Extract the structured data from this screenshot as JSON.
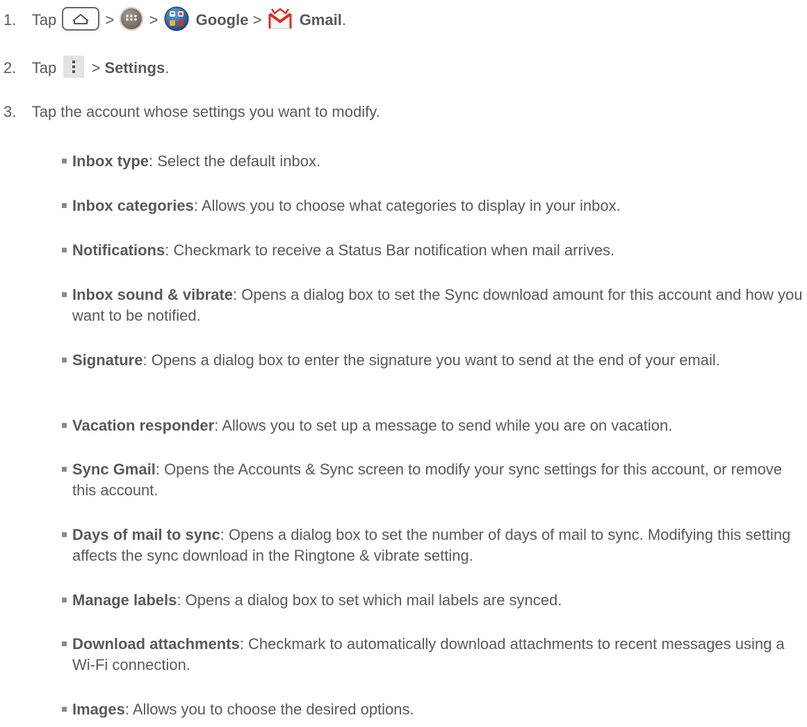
{
  "steps": [
    {
      "number": "1.",
      "tap_word": "Tap",
      "sep": ">",
      "google_label": "Google",
      "gmail_label": "Gmail",
      "end": "."
    },
    {
      "number": "2.",
      "tap_word": "Tap",
      "sep": ">",
      "settings_label": "Settings",
      "end": "."
    },
    {
      "number": "3.",
      "text": "Tap the account whose settings you want to modify."
    }
  ],
  "icons": {
    "home": "home-key-icon",
    "apps": "apps-icon",
    "google": "google-folder-icon",
    "gmail": "gmail-icon",
    "menu": "menu-icon"
  },
  "settings_items": [
    {
      "term": "Inbox type",
      "desc": ": Select the default inbox."
    },
    {
      "term": "Inbox categories",
      "desc": ": Allows you to choose what categories to display in your inbox."
    },
    {
      "term": "Notifications",
      "desc": ": Checkmark to receive a Status Bar notification when mail arrives."
    },
    {
      "term": "Inbox sound & vibrate",
      "desc": ": Opens a dialog box to set the Sync download amount for this account and how you want to be notified."
    },
    {
      "term": "Signature",
      "desc": ": Opens a dialog box to enter the signature you want to send at the end of your email."
    },
    {
      "term": "Vacation responder",
      "desc": ": Allows you to set up a message to send while you are on vacation."
    },
    {
      "term": "Sync Gmail",
      "desc": ": Opens the Accounts & Sync screen to modify your sync settings for this account, or remove this account."
    },
    {
      "term": "Days of mail to sync",
      "desc": ": Opens a dialog box to set the number of days of mail to sync. Modifying this setting affects the sync download in the Ringtone & vibrate setting."
    },
    {
      "term": "Manage labels",
      "desc": ": Opens a dialog box to set which mail labels are synced."
    },
    {
      "term": "Download attachments",
      "desc": ": Checkmark to automatically download attachments to recent messages using a Wi-Fi connection."
    },
    {
      "term": "Images",
      "desc": ": Allows you to choose the desired options."
    }
  ],
  "colors": {
    "text": "#595959",
    "bullet": "#8a8a8a",
    "gmail_red": "#d93025"
  }
}
